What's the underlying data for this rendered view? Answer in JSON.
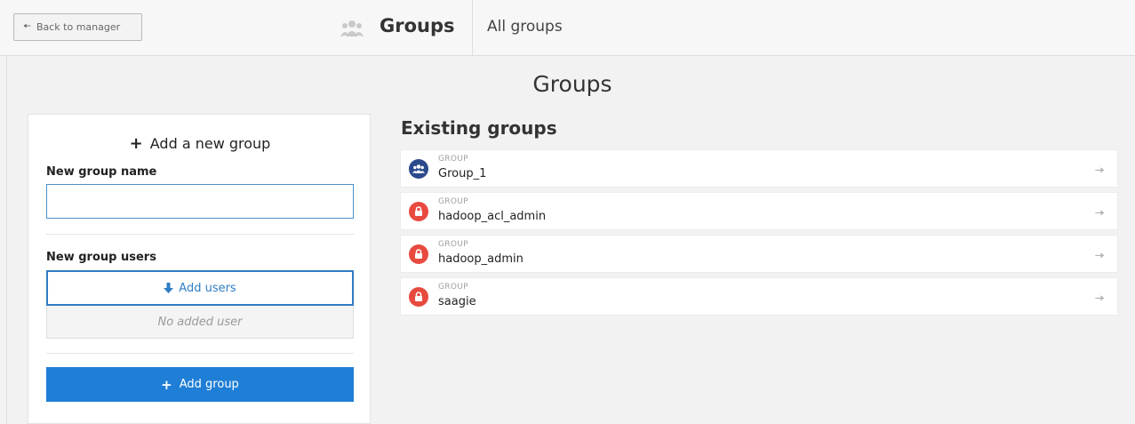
{
  "topbar": {
    "back_label": "Back to manager",
    "back_icon": "arrow-left-icon",
    "section_icon": "users-icon",
    "section_title": "Groups",
    "breadcrumb": "All groups"
  },
  "page": {
    "title": "Groups"
  },
  "add_group_card": {
    "heading": "Add a new group",
    "name_label": "New group name",
    "name_value": "",
    "users_label": "New group users",
    "add_users_label": "Add users",
    "no_users_text": "No added user",
    "submit_label": "Add group"
  },
  "existing": {
    "title": "Existing groups",
    "groups": [
      {
        "kicker": "GROUP",
        "name": "Group_1",
        "icon": "users-icon",
        "color": "#2b4a8c"
      },
      {
        "kicker": "GROUP",
        "name": "hadoop_acl_admin",
        "icon": "lock-icon",
        "color": "#e84a3f"
      },
      {
        "kicker": "GROUP",
        "name": "hadoop_admin",
        "icon": "lock-icon",
        "color": "#e84a3f"
      },
      {
        "kicker": "GROUP",
        "name": "saagie",
        "icon": "lock-icon",
        "color": "#e84a3f"
      }
    ]
  },
  "colors": {
    "primary": "#1f7ed6",
    "lock_red": "#e84a3f",
    "users_navy": "#2b4a8c"
  }
}
